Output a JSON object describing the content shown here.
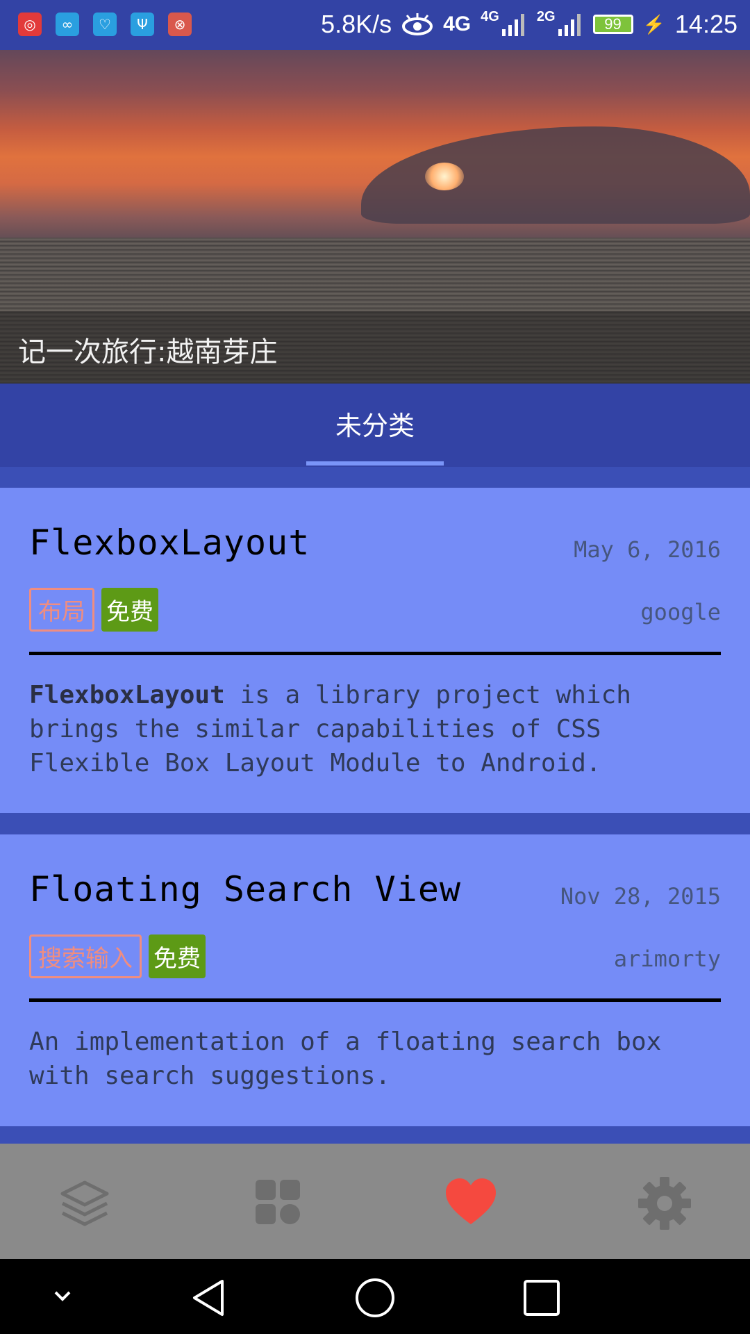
{
  "status_bar": {
    "notification_icons": [
      "netease-music-icon",
      "sync-app-icon",
      "health-monitor-icon",
      "usb-icon",
      "app-close-icon"
    ],
    "net_speed": "5.8K/s",
    "signal_1": "4G",
    "signal_2": "4G",
    "signal_3": "2G",
    "battery": "99",
    "time": "14:25"
  },
  "banner": {
    "caption": "记一次旅行:越南芽庄"
  },
  "tabs": [
    {
      "label": "未分类",
      "selected": true
    }
  ],
  "cards": [
    {
      "title": "FlexboxLayout",
      "date": "May 6, 2016",
      "author": "google",
      "tags": [
        "布局",
        "免费"
      ],
      "desc_bold": "FlexboxLayout",
      "desc_rest": " is a library project which brings the similar capabilities of CSS Flexible Box Layout Module to Android."
    },
    {
      "title": "Floating Search View",
      "date": "Nov 28, 2015",
      "author": "arimorty",
      "tags": [
        "搜索输入",
        "免费"
      ],
      "desc_bold": "",
      "desc_rest": "An implementation of a floating search box with search suggestions."
    }
  ],
  "bottom_nav": [
    {
      "icon": "layers-icon",
      "active": false
    },
    {
      "icon": "grid-icon",
      "active": false
    },
    {
      "icon": "heart-icon",
      "active": true
    },
    {
      "icon": "gear-icon",
      "active": false
    }
  ],
  "colors": {
    "primary": "#3343a5",
    "card": "#758cf7",
    "accent": "#f5493f",
    "tag_outline": "#f08d80",
    "tag_free": "#5d9a16"
  }
}
